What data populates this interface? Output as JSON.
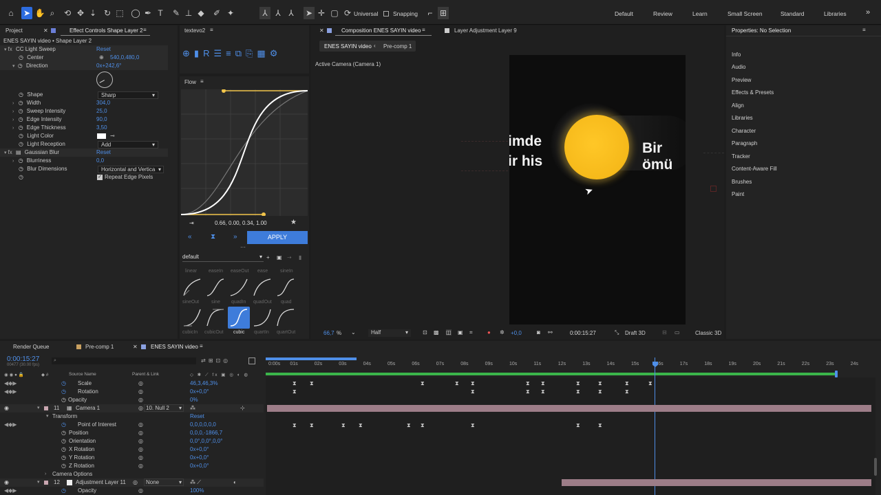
{
  "toolbar": {
    "universal_label": "Universal",
    "snapping_label": "Snapping",
    "workspaces": [
      "Default",
      "Review",
      "Learn",
      "Small Screen",
      "Standard",
      "Libraries"
    ]
  },
  "left_panel": {
    "tab_project": "Project",
    "tab_effect_controls": "Effect Controls Shape Layer 2",
    "layer_path": "ENES SAYIN video • Shape Layer 2",
    "effect1_name": "CC Light Sweep",
    "reset": "Reset",
    "props": [
      {
        "name": "Center",
        "value": "540,0,480,0"
      },
      {
        "name": "Direction",
        "value": "0x+242,6°"
      },
      {
        "name": "Shape",
        "value": "Sharp"
      },
      {
        "name": "Width",
        "value": "304,0"
      },
      {
        "name": "Sweep Intensity",
        "value": "25,0"
      },
      {
        "name": "Edge Intensity",
        "value": "90,0"
      },
      {
        "name": "Edge Thickness",
        "value": "3,50"
      },
      {
        "name": "Light Color",
        "value": ""
      },
      {
        "name": "Light Reception",
        "value": "Add"
      }
    ],
    "effect2_name": "Gaussian Blur",
    "blur_props": [
      {
        "name": "Blurriness",
        "value": "0,0"
      },
      {
        "name": "Blur Dimensions",
        "value": "Horizontal and Vertica"
      }
    ],
    "repeat_edge": "Repeat Edge Pixels"
  },
  "textevo": {
    "tab": "textevo2"
  },
  "flow": {
    "tab": "Flow",
    "curve_values": "0.66, 0.00, 0.34, 1.00",
    "apply": "APPLY",
    "preset": "default",
    "ease_row1": [
      "linear",
      "easeIn",
      "easeOut",
      "ease",
      "sineIn"
    ],
    "ease_row2": [
      "sineOut",
      "sine",
      "quadIn",
      "quadOut",
      "quad"
    ],
    "ease_row3": [
      "cubicIn",
      "cubicOut",
      "cubic",
      "quartIn",
      "quartOut"
    ]
  },
  "composition": {
    "tab": "Composition ENES SAYIN video",
    "layer_tab": "Layer Adjustment Layer 9",
    "breadcrumb1": "ENES SAYIN video",
    "breadcrumb2": "Pre-comp 1",
    "active_camera": "Active Camera (Camera 1)",
    "text_left1": "imde",
    "text_left2": "ir his",
    "text_right": "Bir ömü",
    "zoom": "66,7",
    "zoom_unit": "%",
    "resolution": "Half",
    "exposure": "+0,0",
    "timecode": "0:00:15:27",
    "draft": "Draft 3D",
    "renderer": "Classic 3D"
  },
  "properties": {
    "title": "Properties: No Selection",
    "items": [
      "Info",
      "Audio",
      "Preview",
      "Effects & Presets",
      "Align",
      "Libraries",
      "Character",
      "Paragraph",
      "Tracker",
      "Content-Aware Fill",
      "Brushes",
      "Paint"
    ]
  },
  "timeline": {
    "tabs": [
      "Render Queue",
      "Pre-comp 1",
      "ENES SAYIN video"
    ],
    "current_time": "0:00:15:27",
    "fps": "00477 (30.00 fps)",
    "col_source": "Source Name",
    "col_parent": "Parent & Link",
    "ruler": [
      "0:00s",
      "01s",
      "02s",
      "03s",
      "04s",
      "05s",
      "06s",
      "07s",
      "08s",
      "09s",
      "10s",
      "11s",
      "12s",
      "13s",
      "14s",
      "15s",
      "16s",
      "17s",
      "18s",
      "19s",
      "20s",
      "21s",
      "22s",
      "23s",
      "24s"
    ],
    "rows": [
      {
        "name": "Scale",
        "value": "46,3,46,3%"
      },
      {
        "name": "Rotation",
        "value": "0x+0,0°"
      },
      {
        "name": "Opacity",
        "value": "0%"
      },
      {
        "num": "11",
        "name": "Camera 1",
        "parent": "10. Null 2"
      },
      {
        "name": "Transform",
        "value": "Reset"
      },
      {
        "name": "Point of Interest",
        "value": "0,0,0,0,0,0"
      },
      {
        "name": "Position",
        "value": "0,0,0,-1866,7"
      },
      {
        "name": "Orientation",
        "value": "0,0°,0,0°,0,0°"
      },
      {
        "name": "X Rotation",
        "value": "0x+0,0°"
      },
      {
        "name": "Y Rotation",
        "value": "0x+0,0°"
      },
      {
        "name": "Z Rotation",
        "value": "0x+0,0°"
      },
      {
        "name": "Camera Options",
        "value": ""
      },
      {
        "num": "12",
        "name": "Adjustment Layer 11",
        "parent": "None"
      },
      {
        "name": "Opacity",
        "value": "100%"
      }
    ]
  },
  "colors": {
    "accent": "#2d6cdf",
    "sun": "#f6b91a",
    "curve": "#ffffff",
    "handle": "#f1c44a",
    "green_bar": "#3bb54a",
    "layer_bar": "#9d7d88"
  }
}
